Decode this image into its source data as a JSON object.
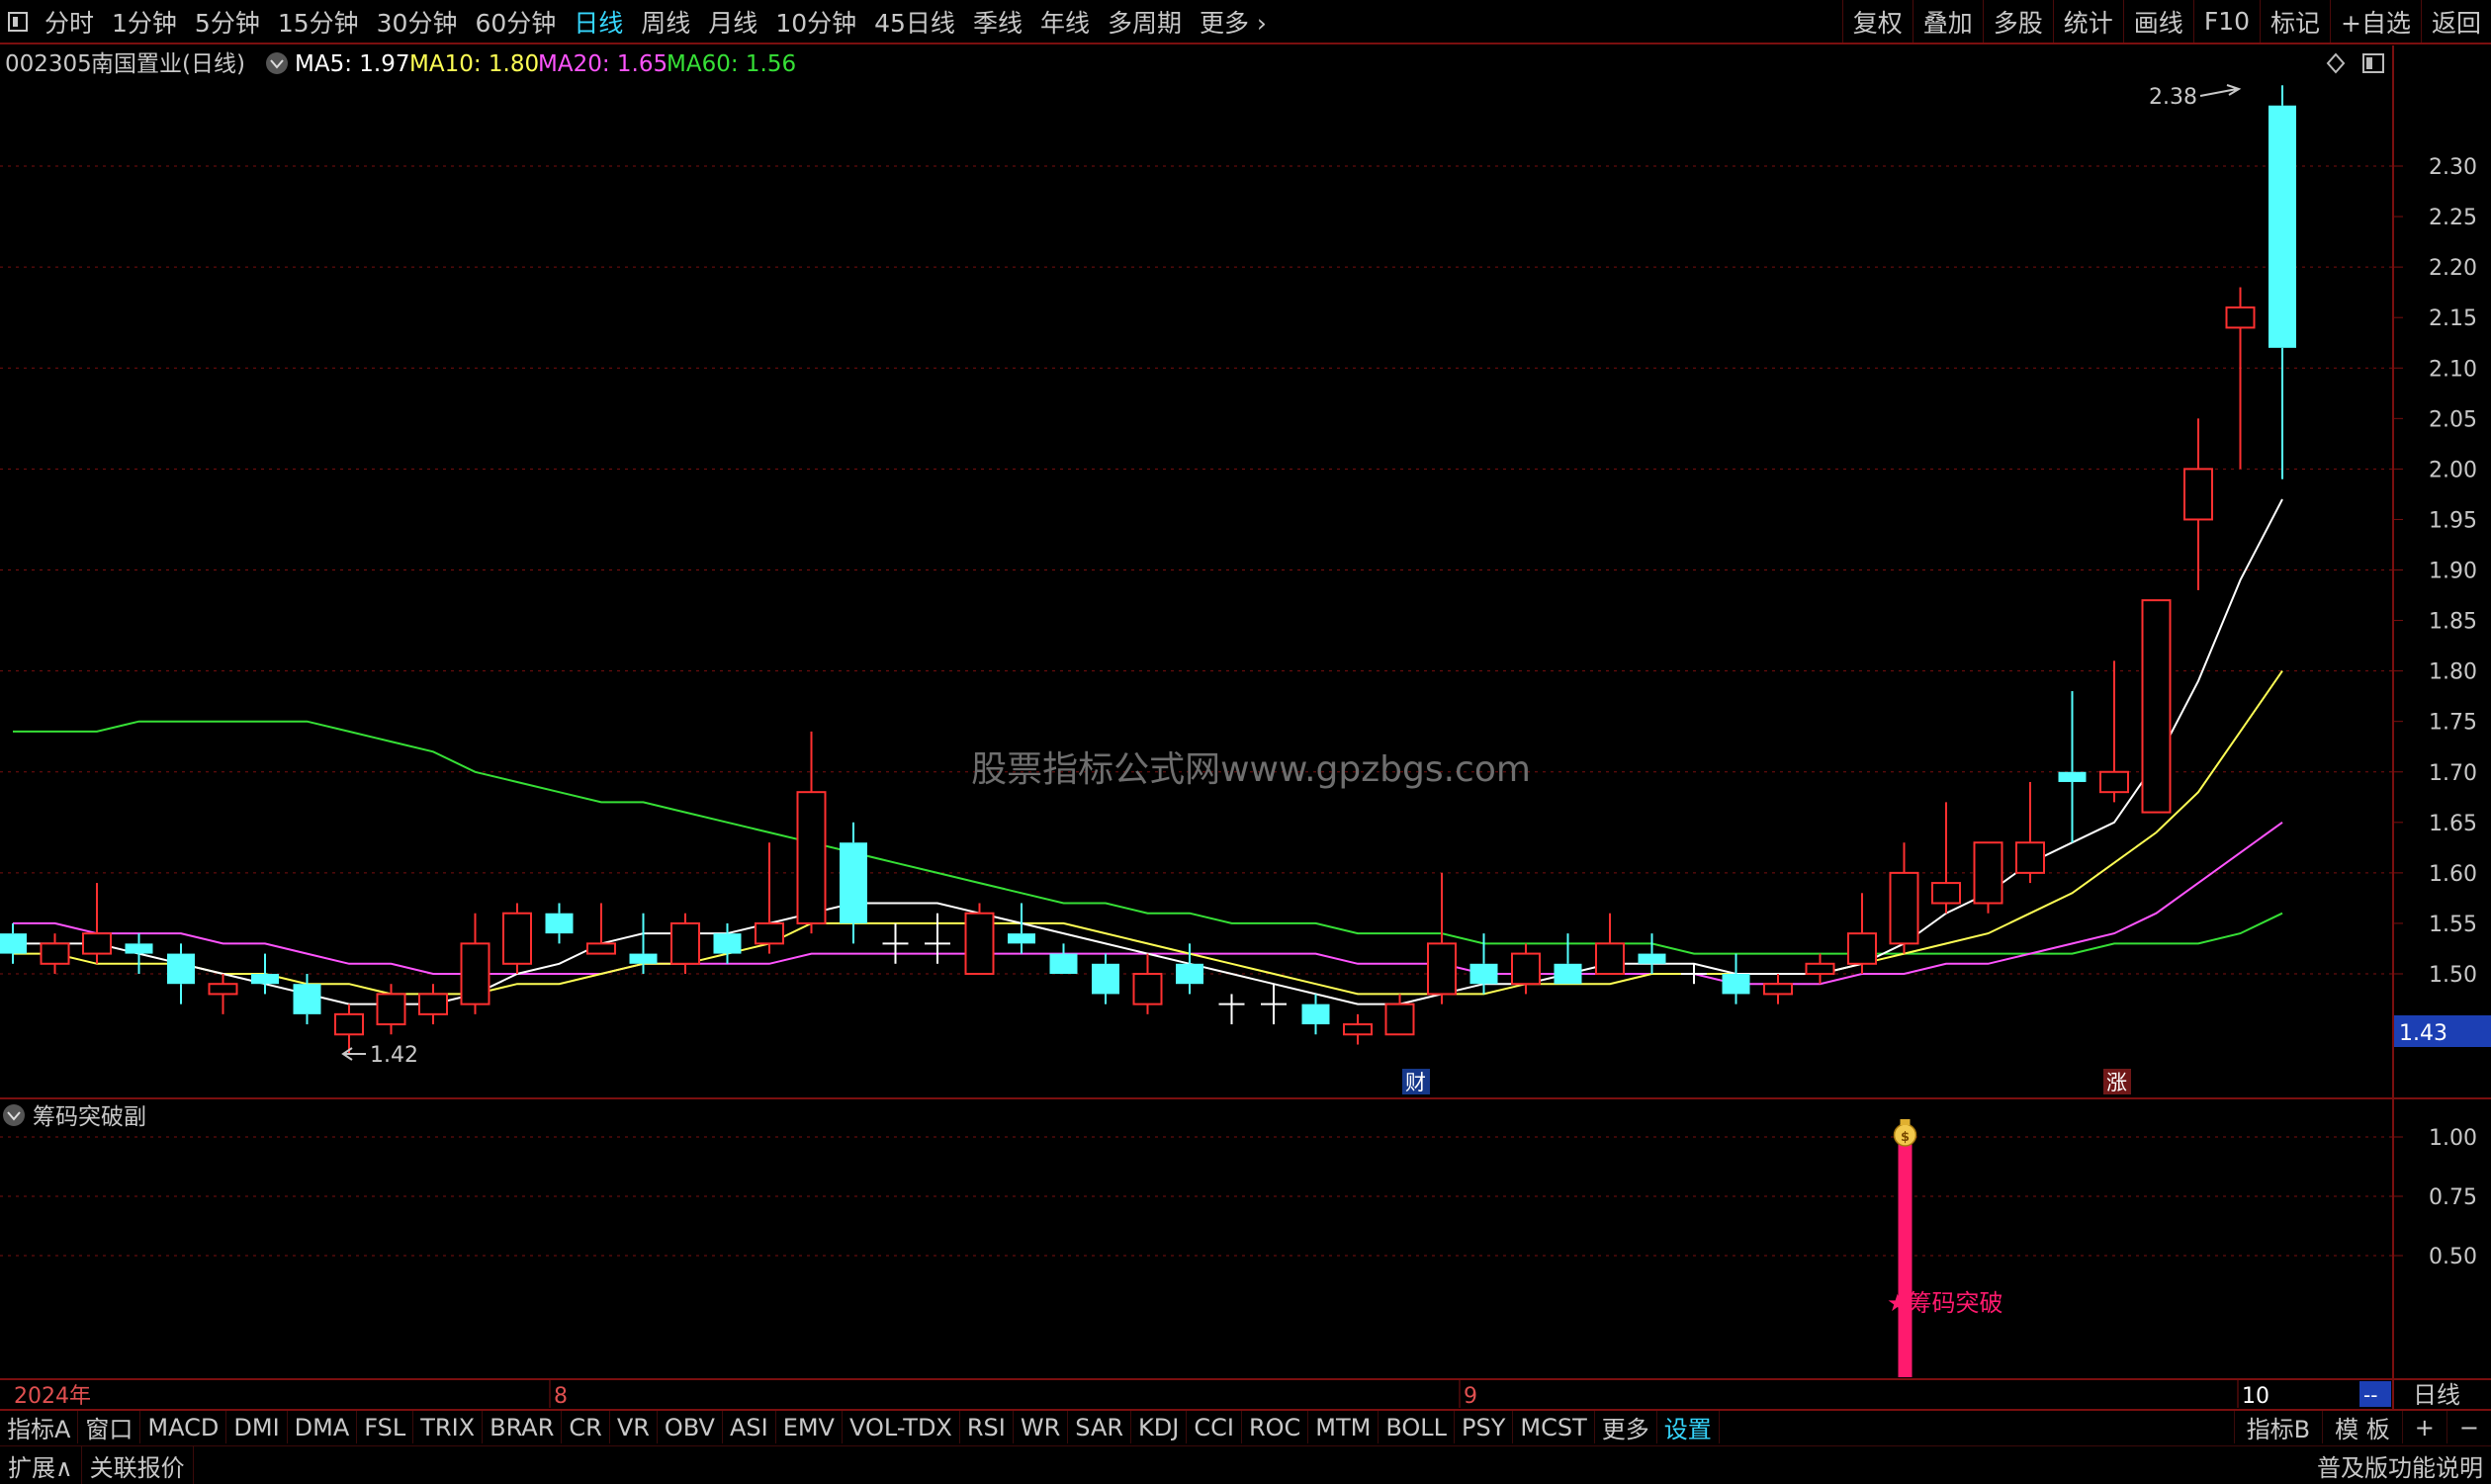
{
  "toolbar": {
    "periods": [
      "分时",
      "1分钟",
      "5分钟",
      "15分钟",
      "30分钟",
      "60分钟",
      "日线",
      "周线",
      "月线",
      "10分钟",
      "45日线",
      "季线",
      "年线",
      "多周期",
      "更多"
    ],
    "active_period": "日线",
    "right": [
      "复权",
      "叠加",
      "多股",
      "统计",
      "画线",
      "F10",
      "标记",
      "+自选",
      "返回"
    ]
  },
  "header": {
    "code": "002305",
    "name": "南国置业(日线)",
    "ma5": "MA5: 1.97",
    "ma10": "MA10: 1.80",
    "ma20": "MA20: 1.65",
    "ma60": "MA60: 1.56"
  },
  "colors": {
    "up": "#ff3030",
    "down": "#54ffff",
    "ma5": "#ffffff",
    "ma10": "#ffff54",
    "ma20": "#ff54ff",
    "ma60": "#36e036",
    "grid": "#7a0f0f",
    "signal": "#ff1a6e"
  },
  "watermark": "股票指标公式网www.gpzbgs.com",
  "price_axis": {
    "ticks": [
      "2.30",
      "2.25",
      "2.20",
      "2.15",
      "2.10",
      "2.05",
      "2.00",
      "1.95",
      "1.90",
      "1.85",
      "1.80",
      "1.75",
      "1.70",
      "1.65",
      "1.60",
      "1.55",
      "1.50"
    ],
    "current_price": "1.43",
    "high_label": "2.38",
    "low_label": "1.42"
  },
  "markers": {
    "cai": "财",
    "zhang": "涨"
  },
  "indicator": {
    "title": "筹码突破副",
    "ticks": [
      "1.00",
      "0.75",
      "0.50"
    ],
    "signal_label": "★筹码突破",
    "signal_icon": "money-bag-icon"
  },
  "date_axis": {
    "labels": [
      "2024年",
      "8",
      "9",
      "10"
    ],
    "period_label": "日线",
    "dash_label": "--"
  },
  "chart_data": {
    "type": "candlestick",
    "ylim": [
      1.4,
      2.38
    ],
    "candles": [
      {
        "o": 1.54,
        "c": 1.52,
        "h": 1.55,
        "l": 1.51
      },
      {
        "o": 1.51,
        "c": 1.53,
        "h": 1.54,
        "l": 1.5
      },
      {
        "o": 1.52,
        "c": 1.54,
        "h": 1.59,
        "l": 1.51
      },
      {
        "o": 1.53,
        "c": 1.52,
        "h": 1.54,
        "l": 1.5
      },
      {
        "o": 1.52,
        "c": 1.49,
        "h": 1.53,
        "l": 1.47
      },
      {
        "o": 1.48,
        "c": 1.49,
        "h": 1.5,
        "l": 1.46
      },
      {
        "o": 1.5,
        "c": 1.49,
        "h": 1.52,
        "l": 1.48
      },
      {
        "o": 1.49,
        "c": 1.46,
        "h": 1.5,
        "l": 1.45
      },
      {
        "o": 1.44,
        "c": 1.46,
        "h": 1.47,
        "l": 1.42
      },
      {
        "o": 1.45,
        "c": 1.48,
        "h": 1.49,
        "l": 1.44
      },
      {
        "o": 1.46,
        "c": 1.48,
        "h": 1.49,
        "l": 1.45
      },
      {
        "o": 1.47,
        "c": 1.53,
        "h": 1.56,
        "l": 1.46
      },
      {
        "o": 1.51,
        "c": 1.56,
        "h": 1.57,
        "l": 1.5
      },
      {
        "o": 1.56,
        "c": 1.54,
        "h": 1.57,
        "l": 1.53
      },
      {
        "o": 1.52,
        "c": 1.53,
        "h": 1.57,
        "l": 1.52
      },
      {
        "o": 1.52,
        "c": 1.51,
        "h": 1.56,
        "l": 1.5
      },
      {
        "o": 1.51,
        "c": 1.55,
        "h": 1.56,
        "l": 1.5
      },
      {
        "o": 1.54,
        "c": 1.52,
        "h": 1.55,
        "l": 1.51
      },
      {
        "o": 1.53,
        "c": 1.55,
        "h": 1.63,
        "l": 1.52
      },
      {
        "o": 1.55,
        "c": 1.68,
        "h": 1.74,
        "l": 1.54
      },
      {
        "o": 1.63,
        "c": 1.55,
        "h": 1.65,
        "l": 1.53
      },
      {
        "o": 1.53,
        "c": 1.53,
        "h": 1.55,
        "l": 1.51
      },
      {
        "o": 1.53,
        "c": 1.53,
        "h": 1.56,
        "l": 1.51
      },
      {
        "o": 1.5,
        "c": 1.56,
        "h": 1.57,
        "l": 1.5
      },
      {
        "o": 1.54,
        "c": 1.53,
        "h": 1.57,
        "l": 1.52
      },
      {
        "o": 1.52,
        "c": 1.5,
        "h": 1.53,
        "l": 1.5
      },
      {
        "o": 1.51,
        "c": 1.48,
        "h": 1.52,
        "l": 1.47
      },
      {
        "o": 1.47,
        "c": 1.5,
        "h": 1.52,
        "l": 1.46
      },
      {
        "o": 1.51,
        "c": 1.49,
        "h": 1.53,
        "l": 1.48
      },
      {
        "o": 1.47,
        "c": 1.47,
        "h": 1.48,
        "l": 1.45
      },
      {
        "o": 1.47,
        "c": 1.47,
        "h": 1.49,
        "l": 1.45
      },
      {
        "o": 1.47,
        "c": 1.45,
        "h": 1.48,
        "l": 1.44
      },
      {
        "o": 1.44,
        "c": 1.45,
        "h": 1.46,
        "l": 1.43
      },
      {
        "o": 1.44,
        "c": 1.47,
        "h": 1.48,
        "l": 1.44
      },
      {
        "o": 1.48,
        "c": 1.53,
        "h": 1.6,
        "l": 1.47
      },
      {
        "o": 1.51,
        "c": 1.49,
        "h": 1.54,
        "l": 1.48
      },
      {
        "o": 1.49,
        "c": 1.52,
        "h": 1.53,
        "l": 1.48
      },
      {
        "o": 1.51,
        "c": 1.49,
        "h": 1.54,
        "l": 1.49
      },
      {
        "o": 1.5,
        "c": 1.53,
        "h": 1.56,
        "l": 1.5
      },
      {
        "o": 1.52,
        "c": 1.51,
        "h": 1.54,
        "l": 1.5
      },
      {
        "o": 1.5,
        "c": 1.5,
        "h": 1.51,
        "l": 1.49
      },
      {
        "o": 1.5,
        "c": 1.48,
        "h": 1.52,
        "l": 1.47
      },
      {
        "o": 1.48,
        "c": 1.49,
        "h": 1.5,
        "l": 1.47
      },
      {
        "o": 1.5,
        "c": 1.51,
        "h": 1.52,
        "l": 1.49
      },
      {
        "o": 1.51,
        "c": 1.54,
        "h": 1.58,
        "l": 1.5
      },
      {
        "o": 1.53,
        "c": 1.6,
        "h": 1.63,
        "l": 1.52
      },
      {
        "o": 1.57,
        "c": 1.59,
        "h": 1.67,
        "l": 1.56
      },
      {
        "o": 1.57,
        "c": 1.63,
        "h": 1.63,
        "l": 1.56
      },
      {
        "o": 1.6,
        "c": 1.63,
        "h": 1.69,
        "l": 1.59
      },
      {
        "o": 1.7,
        "c": 1.69,
        "h": 1.78,
        "l": 1.63
      },
      {
        "o": 1.68,
        "c": 1.7,
        "h": 1.81,
        "l": 1.67
      },
      {
        "o": 1.66,
        "c": 1.87,
        "h": 1.87,
        "l": 1.66
      },
      {
        "o": 1.95,
        "c": 2.0,
        "h": 2.05,
        "l": 1.88
      },
      {
        "o": 2.14,
        "c": 2.16,
        "h": 2.18,
        "l": 2.0
      },
      {
        "o": 2.36,
        "c": 2.12,
        "h": 2.38,
        "l": 1.99
      }
    ],
    "ma5": [
      1.53,
      1.53,
      1.53,
      1.52,
      1.51,
      1.5,
      1.49,
      1.48,
      1.47,
      1.47,
      1.47,
      1.48,
      1.5,
      1.51,
      1.53,
      1.54,
      1.54,
      1.54,
      1.55,
      1.56,
      1.57,
      1.57,
      1.57,
      1.56,
      1.55,
      1.54,
      1.53,
      1.52,
      1.51,
      1.5,
      1.49,
      1.48,
      1.47,
      1.47,
      1.48,
      1.49,
      1.49,
      1.5,
      1.51,
      1.51,
      1.51,
      1.5,
      1.5,
      1.5,
      1.51,
      1.53,
      1.56,
      1.58,
      1.61,
      1.63,
      1.65,
      1.71,
      1.79,
      1.89,
      1.97
    ],
    "ma10": [
      1.52,
      1.52,
      1.51,
      1.51,
      1.51,
      1.5,
      1.5,
      1.49,
      1.49,
      1.48,
      1.48,
      1.48,
      1.49,
      1.49,
      1.5,
      1.51,
      1.51,
      1.52,
      1.53,
      1.55,
      1.55,
      1.55,
      1.55,
      1.55,
      1.55,
      1.55,
      1.54,
      1.53,
      1.52,
      1.51,
      1.5,
      1.49,
      1.48,
      1.48,
      1.48,
      1.48,
      1.49,
      1.49,
      1.49,
      1.5,
      1.5,
      1.5,
      1.5,
      1.5,
      1.51,
      1.52,
      1.53,
      1.54,
      1.56,
      1.58,
      1.61,
      1.64,
      1.68,
      1.74,
      1.8
    ],
    "ma20": [
      1.55,
      1.55,
      1.54,
      1.54,
      1.54,
      1.53,
      1.53,
      1.52,
      1.51,
      1.51,
      1.5,
      1.5,
      1.5,
      1.5,
      1.5,
      1.51,
      1.51,
      1.51,
      1.51,
      1.52,
      1.52,
      1.52,
      1.52,
      1.52,
      1.52,
      1.52,
      1.52,
      1.52,
      1.52,
      1.52,
      1.52,
      1.52,
      1.51,
      1.51,
      1.51,
      1.5,
      1.5,
      1.5,
      1.5,
      1.5,
      1.5,
      1.49,
      1.49,
      1.49,
      1.5,
      1.5,
      1.51,
      1.51,
      1.52,
      1.53,
      1.54,
      1.56,
      1.59,
      1.62,
      1.65
    ],
    "ma60": [
      1.74,
      1.74,
      1.74,
      1.75,
      1.75,
      1.75,
      1.75,
      1.75,
      1.74,
      1.73,
      1.72,
      1.7,
      1.69,
      1.68,
      1.67,
      1.67,
      1.66,
      1.65,
      1.64,
      1.63,
      1.62,
      1.61,
      1.6,
      1.59,
      1.58,
      1.57,
      1.57,
      1.56,
      1.56,
      1.55,
      1.55,
      1.55,
      1.54,
      1.54,
      1.54,
      1.53,
      1.53,
      1.53,
      1.53,
      1.53,
      1.52,
      1.52,
      1.52,
      1.52,
      1.52,
      1.52,
      1.52,
      1.52,
      1.52,
      1.52,
      1.53,
      1.53,
      1.53,
      1.54,
      1.56
    ],
    "indicator_values": [
      {
        "index": 45,
        "value": 1.0
      }
    ]
  },
  "bottom_tabs": {
    "items": [
      "指标A",
      "窗口",
      "MACD",
      "DMI",
      "DMA",
      "FSL",
      "TRIX",
      "BRAR",
      "CR",
      "VR",
      "OBV",
      "ASI",
      "EMV",
      "VOL-TDX",
      "RSI",
      "WR",
      "SAR",
      "KDJ",
      "CCI",
      "ROC",
      "MTM",
      "BOLL",
      "PSY",
      "MCST",
      "更多",
      "设置"
    ],
    "highlight": "设置",
    "right": [
      "指标B",
      "模 板",
      "+",
      "−"
    ]
  },
  "status_bar": {
    "expand": "扩展∧",
    "linked": "关联报价",
    "right": "普及版功能说明"
  }
}
